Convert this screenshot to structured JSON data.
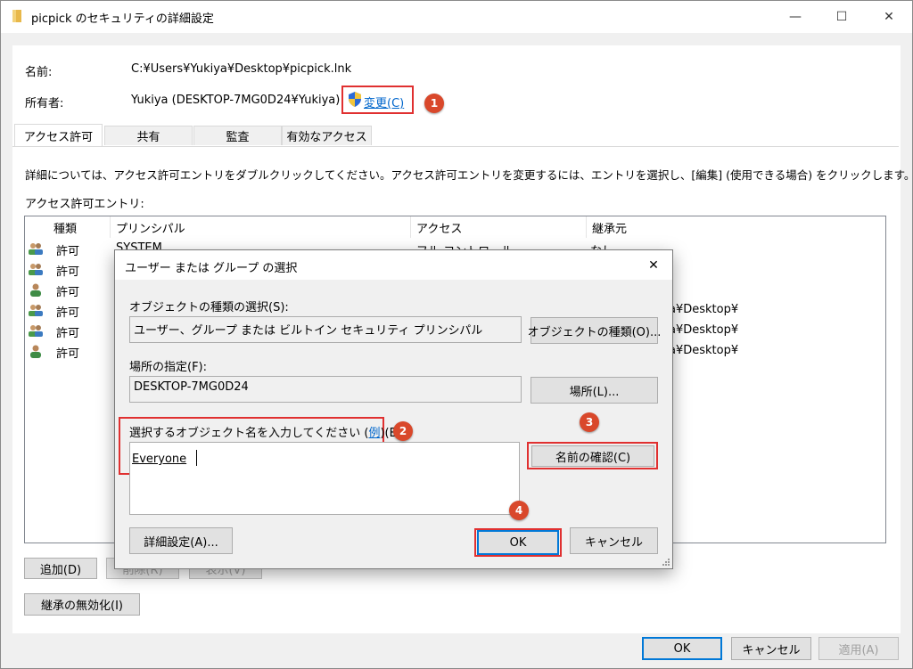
{
  "window": {
    "title": "picpick のセキュリティの詳細設定",
    "minimize_glyph": "—",
    "maximize_glyph": "☐",
    "close_glyph": "✕"
  },
  "info": {
    "name_label": "名前:",
    "name_value": "C:¥Users¥Yukiya¥Desktop¥picpick.lnk",
    "owner_label": "所有者:",
    "owner_value": "Yukiya (DESKTOP-7MG0D24¥Yukiya)",
    "change_link": "変更(C)"
  },
  "tabs": [
    {
      "label": "アクセス許可"
    },
    {
      "label": "共有"
    },
    {
      "label": "監査"
    },
    {
      "label": "有効なアクセス"
    }
  ],
  "description": "詳細については、アクセス許可エントリをダブルクリックしてください。アクセス許可エントリを変更するには、エントリを選択し、[編集] (使用できる場合) をクリックします。",
  "entries_label": "アクセス許可エントリ:",
  "table": {
    "headers": [
      "種類",
      "プリンシパル",
      "アクセス",
      "継承元"
    ],
    "rows": [
      {
        "type": "許可",
        "principal": "SYSTEM",
        "access": "フル コントロール",
        "inherit": "なし",
        "icon": "group-icon"
      },
      {
        "type": "許可",
        "principal": "",
        "access": "",
        "inherit": "",
        "icon": "group-icon"
      },
      {
        "type": "許可",
        "principal": "",
        "access": "",
        "inherit": "",
        "icon": "user-icon"
      },
      {
        "type": "許可",
        "principal": "",
        "access": "",
        "inherit": "a¥Desktop¥",
        "icon": "group-icon"
      },
      {
        "type": "許可",
        "principal": "",
        "access": "",
        "inherit": "a¥Desktop¥",
        "icon": "group-icon"
      },
      {
        "type": "許可",
        "principal": "",
        "access": "",
        "inherit": "a¥Desktop¥",
        "icon": "user-icon"
      }
    ]
  },
  "buttons": {
    "add": "追加(D)",
    "remove": "削除(R)",
    "view": "表示(V)",
    "disable_inheritance": "継承の無効化(I)",
    "ok": "OK",
    "cancel": "キャンセル",
    "apply": "適用(A)"
  },
  "dialog": {
    "title": "ユーザー または グループ の選択",
    "object_type_label": "オブジェクトの種類の選択(S):",
    "object_type_value": "ユーザー、グループ または ビルトイン セキュリティ プリンシパル",
    "object_type_button": "オブジェクトの種類(O)...",
    "location_label": "場所の指定(F):",
    "location_value": "DESKTOP-7MG0D24",
    "location_button": "場所(L)...",
    "enter_label_prefix": "選択するオブジェクト名を入力してください (",
    "enter_label_link": "例",
    "enter_label_suffix": ")(E):",
    "enter_value": "Everyone",
    "check_names_button": "名前の確認(C)",
    "advanced_button": "詳細設定(A)...",
    "ok_button": "OK",
    "cancel_button": "キャンセル"
  },
  "annotations": [
    "1",
    "2",
    "3",
    "4"
  ],
  "colors": {
    "accent_red": "#e03030",
    "badge": "#d9482b",
    "link": "#0066cc"
  }
}
